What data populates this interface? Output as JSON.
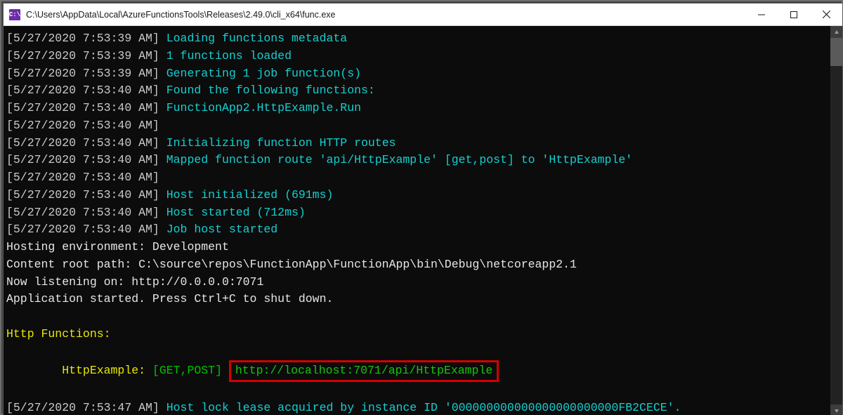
{
  "window": {
    "title": "C:\\Users\\AppData\\Local\\AzureFunctionsTools\\Releases\\2.49.0\\cli_x64\\func.exe"
  },
  "log": [
    {
      "ts": "[5/27/2020 7:53:39 AM]",
      "msg": "Loading functions metadata"
    },
    {
      "ts": "[5/27/2020 7:53:39 AM]",
      "msg": "1 functions loaded"
    },
    {
      "ts": "[5/27/2020 7:53:39 AM]",
      "msg": "Generating 1 job function(s)"
    },
    {
      "ts": "[5/27/2020 7:53:40 AM]",
      "msg": "Found the following functions:"
    },
    {
      "ts": "[5/27/2020 7:53:40 AM]",
      "msg": "FunctionApp2.HttpExample.Run"
    },
    {
      "ts": "[5/27/2020 7:53:40 AM]",
      "msg": ""
    },
    {
      "ts": "[5/27/2020 7:53:40 AM]",
      "msg": "Initializing function HTTP routes"
    },
    {
      "ts": "[5/27/2020 7:53:40 AM]",
      "msg": "Mapped function route 'api/HttpExample' [get,post] to 'HttpExample'"
    },
    {
      "ts": "[5/27/2020 7:53:40 AM]",
      "msg": ""
    },
    {
      "ts": "[5/27/2020 7:53:40 AM]",
      "msg": "Host initialized (691ms)"
    },
    {
      "ts": "[5/27/2020 7:53:40 AM]",
      "msg": "Host started (712ms)"
    },
    {
      "ts": "[5/27/2020 7:53:40 AM]",
      "msg": "Job host started"
    },
    {
      "ts": "[5/27/2020 7:53:47 AM]",
      "msg": "Host lock lease acquired by instance ID '000000000000000000000000FB2CECE'."
    }
  ],
  "plain": [
    "Hosting environment: Development",
    "Content root path: C:\\source\\repos\\FunctionApp\\FunctionApp\\bin\\Debug\\netcoreapp2.1",
    "Now listening on: http://0.0.0.0:7071",
    "Application started. Press Ctrl+C to shut down."
  ],
  "http": {
    "header": "Http Functions:",
    "fn_label": "HttpExample:",
    "methods": "[GET,POST]",
    "url": "http://localhost:7071/api/HttpExample"
  }
}
